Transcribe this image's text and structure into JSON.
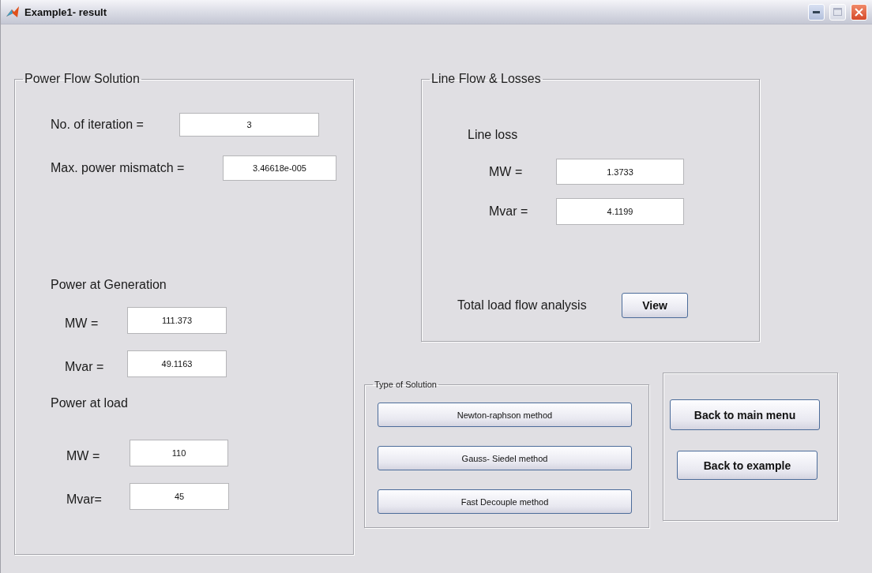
{
  "window": {
    "title": "Example1- result"
  },
  "power_flow_solution": {
    "title": "Power Flow Solution",
    "rows": [
      {
        "kind": "field",
        "label": "No. of iteration =",
        "value": "3"
      },
      {
        "kind": "field",
        "label": "Max. power mismatch =",
        "value": "3.46618e-005"
      },
      {
        "kind": "heading",
        "label": "Power at Generation"
      },
      {
        "kind": "field",
        "label": "MW =",
        "value": "111.373"
      },
      {
        "kind": "field",
        "label": "Mvar =",
        "value": "49.1163"
      },
      {
        "kind": "heading",
        "label": "Power at load"
      },
      {
        "kind": "field",
        "label": "MW =",
        "value": "110"
      },
      {
        "kind": "field",
        "label": "Mvar=",
        "value": "45"
      }
    ]
  },
  "line_flow_losses": {
    "title": "Line Flow & Losses",
    "rows": [
      {
        "kind": "heading",
        "label": "Line loss"
      },
      {
        "kind": "field",
        "label": "MW =",
        "value": "1.3733"
      },
      {
        "kind": "field",
        "label": "Mvar =",
        "value": "4.1199"
      },
      {
        "kind": "button",
        "label": "Total load flow analysis",
        "button": "View"
      }
    ]
  },
  "type_of_solution": {
    "title": "Type of Solution",
    "buttons": [
      "Newton-raphson method",
      "Gauss- Siedel method",
      "Fast Decouple method"
    ]
  },
  "navigation": {
    "buttons": [
      "Back to main menu",
      "Back to example"
    ]
  }
}
